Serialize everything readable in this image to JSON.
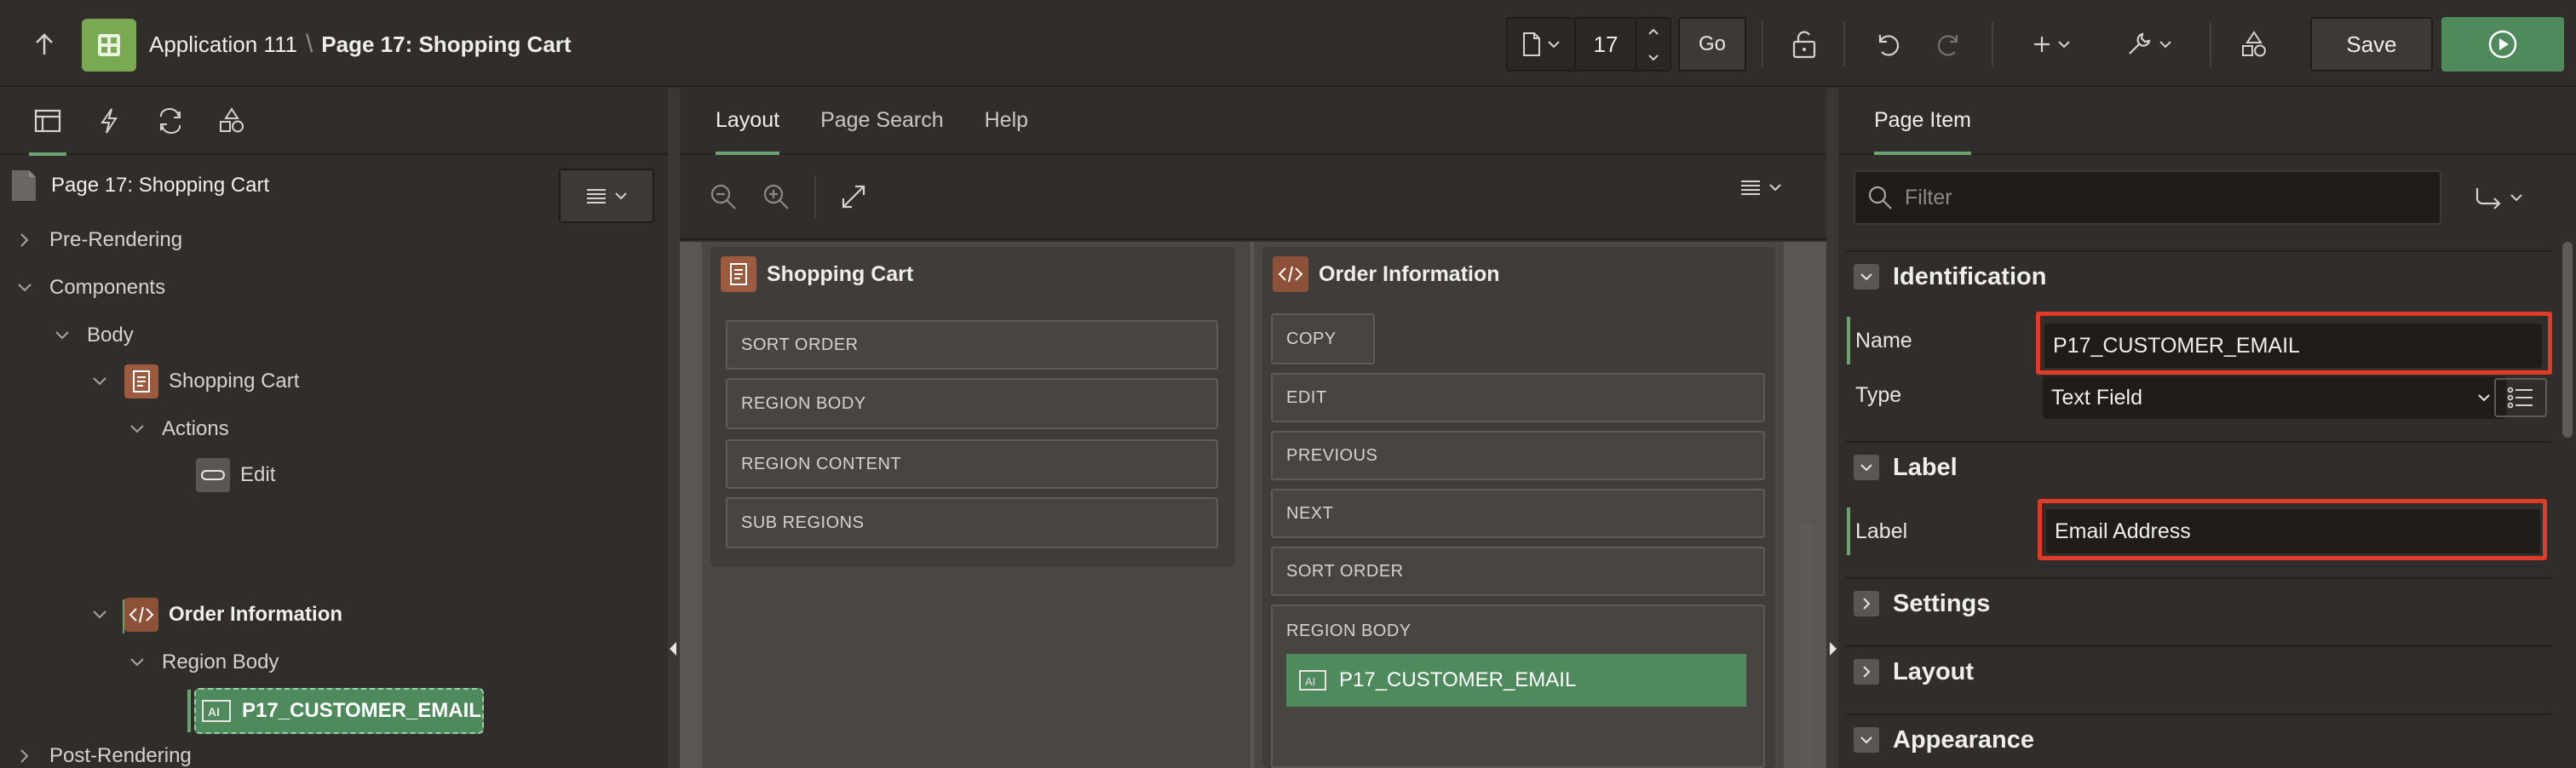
{
  "header": {
    "app_name": "Application 111",
    "separator": "\\",
    "page_title": "Page 17: Shopping Cart",
    "page_number": "17",
    "go_label": "Go",
    "save_label": "Save"
  },
  "left": {
    "tree_title": "Page 17: Shopping Cart",
    "nodes": {
      "pre_rendering": "Pre-Rendering",
      "components": "Components",
      "body": "Body",
      "shopping_cart": "Shopping Cart",
      "actions": "Actions",
      "edit": "Edit",
      "order_information": "Order Information",
      "region_body": "Region Body",
      "customer_email": "P17_CUSTOMER_EMAIL",
      "post_rendering": "Post-Rendering"
    }
  },
  "center": {
    "tabs": [
      "Layout",
      "Page Search",
      "Help"
    ],
    "shopping_cart": {
      "title": "Shopping Cart",
      "slots": [
        "SORT ORDER",
        "REGION BODY",
        "REGION CONTENT",
        "SUB REGIONS"
      ]
    },
    "order_information": {
      "title": "Order Information",
      "slots": [
        "COPY",
        "EDIT",
        "PREVIOUS",
        "NEXT",
        "SORT ORDER",
        "REGION BODY"
      ],
      "item": "P17_CUSTOMER_EMAIL"
    }
  },
  "right": {
    "tab": "Page Item",
    "filter_placeholder": "Filter",
    "sections": {
      "identification": "Identification",
      "label": "Label",
      "settings": "Settings",
      "layout": "Layout",
      "appearance": "Appearance"
    },
    "props": {
      "name_label": "Name",
      "name_value": "P17_CUSTOMER_EMAIL",
      "type_label": "Type",
      "type_value": "Text Field",
      "label_label": "Label",
      "label_value": "Email Address"
    }
  },
  "colors": {
    "accent_green": "#6aa56f",
    "run_button": "#4e8a5c",
    "app_logo": "#7aa954",
    "highlight": "#e03a28"
  }
}
